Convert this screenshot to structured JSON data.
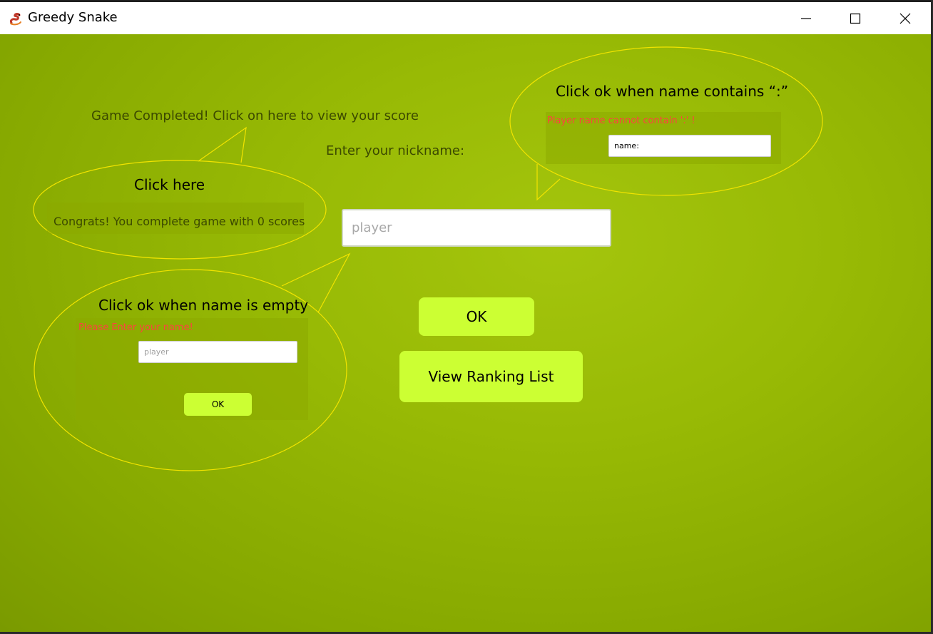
{
  "window": {
    "title": "Greedy Snake",
    "minimize_symbol": "—",
    "close_symbol": "✕"
  },
  "main": {
    "game_completed_link": "Game Completed! Click on here to view your score",
    "nickname_label": "Enter your nickname:",
    "nickname_placeholder": "player",
    "ok_label": "OK",
    "ranking_label": "View Ranking List"
  },
  "callouts": {
    "click_here": {
      "title": "Click here",
      "message": "Congrats! You complete game  with 0 scores"
    },
    "empty_name": {
      "title": "Click ok when name is empty",
      "error": "Please Enter your name!",
      "placeholder": "player",
      "ok_label": "OK"
    },
    "colon_name": {
      "title": "Click ok when name contains   “:”",
      "error": "Player name cannot contain ':' !",
      "value": "name:"
    }
  },
  "colors": {
    "background": "#8db000",
    "button": "#ccff33",
    "callout_outline": "#f2e400",
    "error_text": "#ff4040"
  },
  "icons": {
    "app": "snake-icon",
    "minimize": "minimize-icon",
    "maximize": "maximize-icon",
    "close": "close-icon"
  }
}
